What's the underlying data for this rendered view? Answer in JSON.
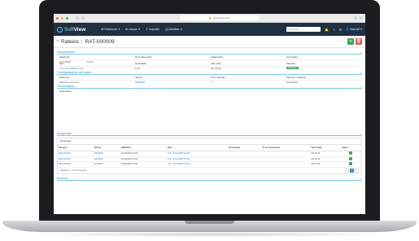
{
  "browser": {
    "url": "softview.com.br"
  },
  "app": {
    "brand_a": "Soft",
    "brand_b": "View",
    "menu": [
      {
        "label": "Gerenciar"
      },
      {
        "label": "Lançar"
      },
      {
        "label": "Importar"
      },
      {
        "label": "Analisar"
      }
    ],
    "search_placeholder": "Pesquisar",
    "user": "Manoel"
  },
  "page": {
    "title": "Rateios",
    "separator": "|",
    "code": "RAT-000009"
  },
  "sections": {
    "info": "Informações",
    "config": "Configurações de rateio",
    "obs": "Observação",
    "desp": "Despesas",
    "anexos": "Anexos"
  },
  "info": {
    "row1": [
      {
        "label": "Data/Hora",
        "value": "10/11/2020",
        "value2": "10:19"
      },
      {
        "label": "Nº do documento",
        "value": ""
      },
      {
        "label": "Colaborador",
        "value": ""
      },
      {
        "label": "Fornecedor",
        "value": ""
      }
    ],
    "row2": [
      {
        "label": "Item",
        "value": "123 - ROLAMENTO DP"
      },
      {
        "label": "Quantidade",
        "value": "1,00"
      },
      {
        "label": "Valor total",
        "value": "R$ 105,00"
      },
      {
        "label": "Situação",
        "value": "Finalizado"
      }
    ]
  },
  "config": [
    {
      "label": "Rateio por:",
      "value": "Despesa recorrente"
    },
    {
      "label": "Veículo",
      "value": "AZE3E08"
    },
    {
      "label": "Nº de parcelas",
      "value": "3"
    },
    {
      "label": "Data da 1ª despesa",
      "value": "10/10/2020"
    }
  ],
  "obs": {
    "label": "Observação"
  },
  "table": {
    "caption": "Despesas",
    "headers": [
      "Despesa",
      "Veículo",
      "Data/Hora",
      "Item",
      "Fornecedor",
      "Nº de documento",
      "Valor total",
      "Ações"
    ],
    "rows": [
      [
        "DES-000205",
        "AZE3E08",
        "10/10/2020 00:00",
        "123 - ROLAMENTO DP",
        "",
        "",
        "R$ 35,33"
      ],
      [
        "DES-000204",
        "AZE3E08",
        "10/11/2020 00:00",
        "123 - ROLAMENTO DP",
        "",
        "",
        "R$ 35,33"
      ],
      [
        "DES-000203",
        "AZE3E08",
        "10/12/2020 00:00",
        "123 - ROLAMENTO DP",
        "",
        "",
        "R$ 35,33"
      ]
    ],
    "footer": "Exibindo 1 - 3 de 3 registros",
    "page": "1"
  },
  "colors": {
    "nav": "#203043",
    "accent": "#2e8fc4",
    "success": "#3aa85b",
    "danger": "#e05a5a"
  }
}
